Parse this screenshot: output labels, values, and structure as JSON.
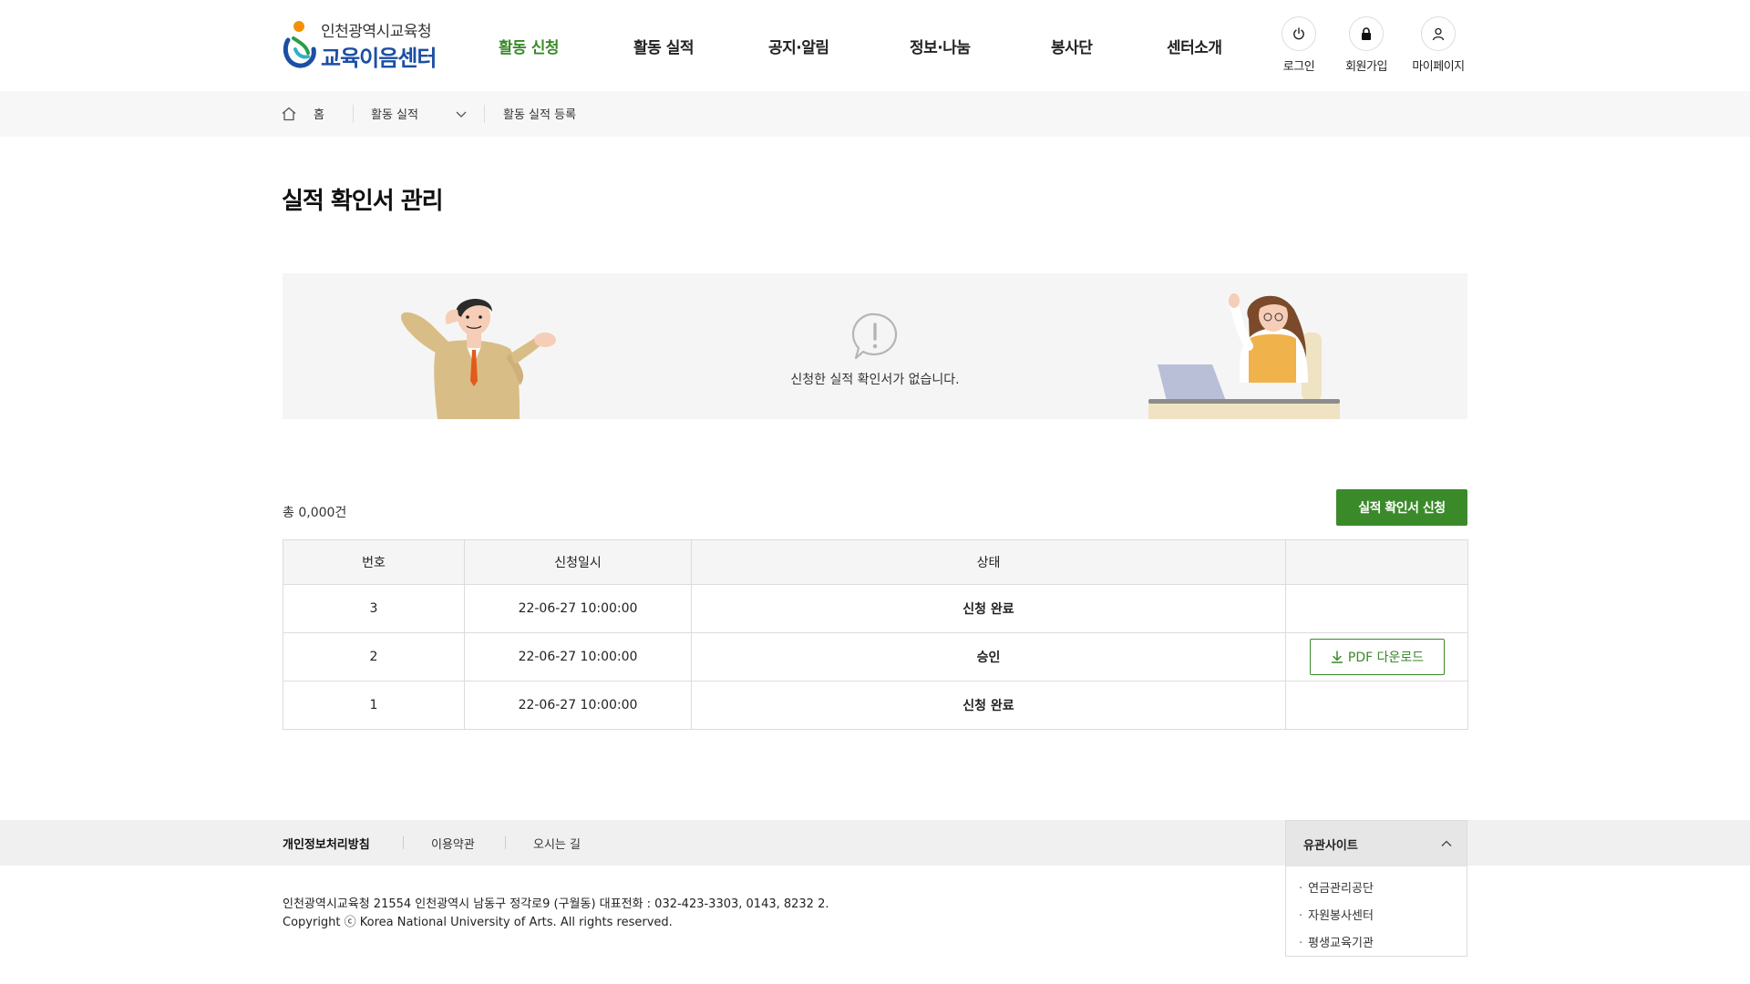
{
  "header": {
    "logo_top": "인천광역시교육청",
    "logo_bottom": "교육이음센터",
    "nav": [
      "활동 신청",
      "활동 실적",
      "공지·알림",
      "정보·나눔",
      "봉사단",
      "센터소개"
    ],
    "active_nav": "활동 신청",
    "util": [
      {
        "label": "로그인",
        "icon": "power-icon"
      },
      {
        "label": "회원가입",
        "icon": "lock-icon"
      },
      {
        "label": "마이페이지",
        "icon": "user-icon"
      }
    ]
  },
  "breadcrumb": {
    "home": "홈",
    "section": "활동 실적",
    "current": "활동 실적 등록"
  },
  "page_title": "실적 확인서 관리",
  "empty_banner": {
    "icon": "alert-speech-bubble-icon",
    "message": "신청한 실적 확인서가 없습니다."
  },
  "list": {
    "count_text": "총 0,000건",
    "apply_button": "실적 확인서 신청",
    "columns": [
      "번호",
      "신청일시",
      "상태",
      ""
    ],
    "rows": [
      {
        "no": "3",
        "date": "22-06-27 10:00:00",
        "status": "신청 완료",
        "action": ""
      },
      {
        "no": "2",
        "date": "22-06-27 10:00:00",
        "status": "승인",
        "action": "PDF 다운로드"
      },
      {
        "no": "1",
        "date": "22-06-27 10:00:00",
        "status": "신청 완료",
        "action": ""
      }
    ]
  },
  "footer": {
    "links": [
      "개인정보처리방침",
      "이용약관",
      "오시는 길"
    ],
    "family_title": "유관사이트",
    "family_sites": [
      "연금관리공단",
      "자원봉사센터",
      "평생교육기관"
    ],
    "address": "인천광역시교육청 21554 인천광역시 남동구 정각로9 (구월동) 대표전화 : 032-423-3303, 0143, 8232 2.",
    "copyright": "Copyright ⓒ Korea National University of Arts. All rights reserved."
  },
  "colors": {
    "accent": "#3a8a2a",
    "logo_blue": "#1b4fa3",
    "logo_orange": "#f39200"
  }
}
